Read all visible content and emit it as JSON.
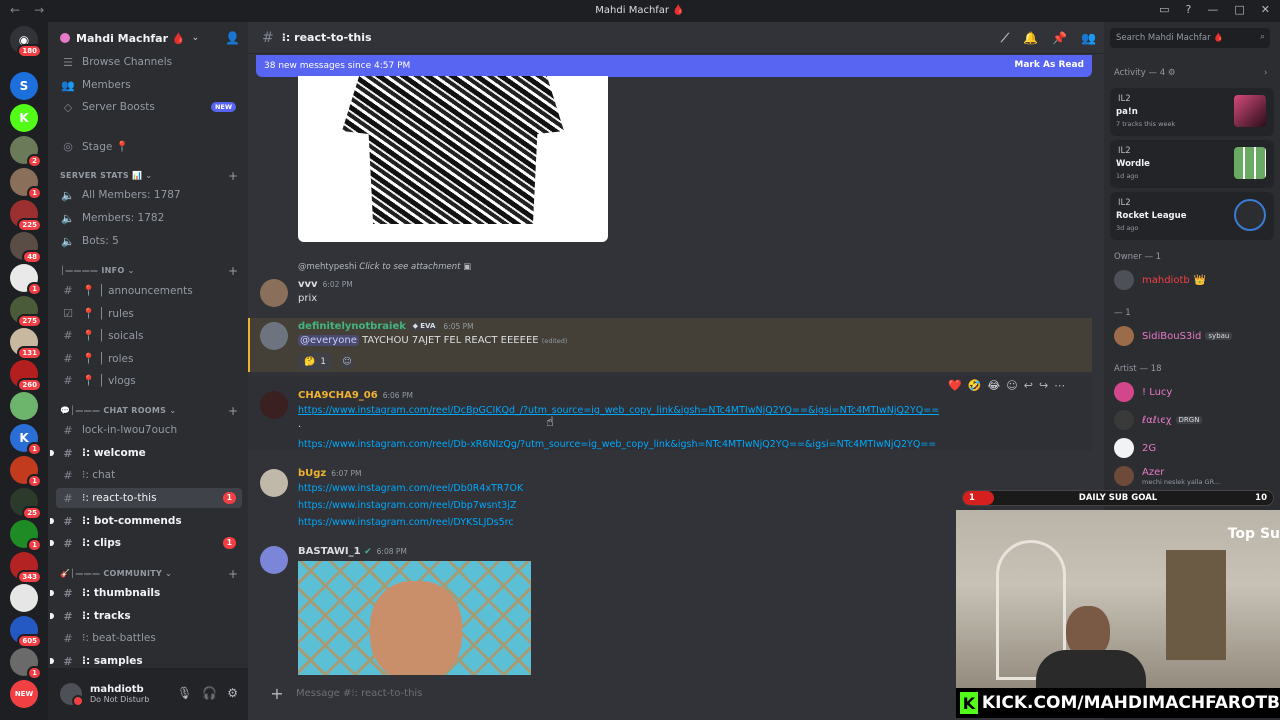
{
  "titlebar": {
    "title": "Mahdi Machfar 🩸"
  },
  "rail": {
    "home_badge": "180",
    "servers": [
      {
        "label": "S",
        "color": "#1d6fdc",
        "badge": ""
      },
      {
        "label": "K",
        "color": "#53fc18",
        "badge": ""
      },
      {
        "label": "",
        "color": "#6b7b5a",
        "badge": "2"
      },
      {
        "label": "",
        "color": "#8a6f5a",
        "badge": "1"
      },
      {
        "label": "",
        "color": "#9c2f2f",
        "badge": "225"
      },
      {
        "label": "",
        "color": "#5a4d46",
        "badge": "48"
      },
      {
        "label": "",
        "color": "#e9e9e9",
        "badge": "1"
      },
      {
        "label": "",
        "color": "#4a5b3a",
        "badge": "275"
      },
      {
        "label": "",
        "color": "#c9b8a0",
        "badge": "131"
      },
      {
        "label": "",
        "color": "#b31e1e",
        "badge": "260"
      },
      {
        "label": "",
        "color": "#6db56d",
        "badge": ""
      },
      {
        "label": "K",
        "color": "#2b6fd6",
        "badge": "1"
      },
      {
        "label": "",
        "color": "#c23b1e",
        "badge": "1"
      },
      {
        "label": "",
        "color": "#2b3a2a",
        "badge": "25"
      },
      {
        "label": "",
        "color": "#1f8b24",
        "badge": "1"
      },
      {
        "label": "",
        "color": "#b42323",
        "badge": "343"
      },
      {
        "label": "",
        "color": "#e6e6e6",
        "badge": ""
      },
      {
        "label": "",
        "color": "#2459c4",
        "badge": "605"
      },
      {
        "label": "",
        "color": "#6a6a6a",
        "badge": "1"
      },
      {
        "label": "NEW",
        "color": "#f23f43",
        "badge": ""
      }
    ]
  },
  "guild": {
    "name": "Mahdi Machfar 🩸",
    "browse": "Browse Channels",
    "members": "Members",
    "boosts": "Server Boosts",
    "boosts_badge": "NEW",
    "stage": "Stage 📍",
    "cat_stats": "SERVER STATS 📊",
    "stat_all": "All Members: 1787",
    "stat_members": "Members: 1782",
    "stat_bots": "Bots: 5",
    "cat_info": "│———— INFO",
    "info": [
      "📍 │ announcements",
      "📍 │ rules",
      "📍 │ soicals",
      "📍 │ roles",
      "📍 │ vlogs"
    ],
    "cat_chat": "💬│——— CHAT ROOMS",
    "lock": "lock-in-lwou7ouch",
    "welcome": "⁝: welcome",
    "chat": "⁝: chat",
    "react": "⁝: react-to-this",
    "react_count": "1",
    "botcmd": "⁝: bot-commends",
    "clips": "⁝: clips",
    "clips_count": "1",
    "cat_community": "🎸│——— COMMUNITY",
    "thumbnails": "⁝: thumbnails",
    "tracks": "⁝: tracks",
    "beat": "⁝: beat-battles",
    "samples": "⁝: samples"
  },
  "user": {
    "name": "mahdiotb",
    "status": "Do Not Disturb"
  },
  "chat": {
    "channel": "⁝: react-to-this",
    "new_messages": "38 new messages since 4:57 PM",
    "mark_read": "Mark As Read",
    "reply_ref": "@mehtypeshi",
    "reply_attach": "Click to see attachment",
    "messages": [
      {
        "author": "vvv",
        "time": "6:02 PM",
        "color": "#f2f3f5",
        "text": "prix"
      },
      {
        "author": "definitelynotbraiek",
        "tag": "EVA",
        "time": "6:05 PM",
        "color": "#43b581",
        "mention": "@everyone",
        "text": "TAYCHOU 7AJET FEL REACT EEEEEE",
        "edited": "(edited)",
        "reaction_count": "1"
      },
      {
        "author": "CHA9CHA9_06",
        "time": "6:06 PM",
        "color": "#f0b232",
        "links": [
          "https://www.instagram.com/reel/DcBpGCIKQd_/?utm_source=ig_web_copy_link&igsh=NTc4MTIwNjQ2YQ==&igsi=NTc4MTIwNjQ2YQ==",
          ".",
          "https://www.instagram.com/reel/Db-xR6NIzQg/?utm_source=ig_web_copy_link&igsh=NTc4MTIwNjQ2YQ==&igsi=NTc4MTIwNjQ2YQ=="
        ]
      },
      {
        "author": "bUgz",
        "time": "6:07 PM",
        "color": "#f0b232",
        "links": [
          "https://www.instagram.com/reel/Db0R4xTR7OK",
          "https://www.instagram.com/reel/Dbp7wsnt3jZ",
          "https://www.instagram.com/reel/DYKSLJDs5rc"
        ]
      },
      {
        "author": "BASTAWI_1",
        "time": "6:08 PM",
        "color": "#f2f3f5"
      }
    ],
    "composer_placeholder": "Message #⁝: react-to-this"
  },
  "right": {
    "search_placeholder": "Search Mahdi Machfar 🩸",
    "activity_header": "Activity — 4",
    "activities": [
      {
        "name": "IL2",
        "title": "pa!n",
        "detail": "7 tracks this week"
      },
      {
        "name": "IL2",
        "title": "Wordle",
        "detail": "1d ago"
      },
      {
        "name": "IL2",
        "title": "Rocket League",
        "detail": "3d ago"
      }
    ],
    "owner_header": "Owner — 1",
    "owner": "mahdiotb",
    "role_header": "— 1",
    "role_member": "SidiBouS3id",
    "role_member_tag": "sybau",
    "artist_header": "Artist — 18",
    "artists": [
      "! Lucy",
      "ℓαℓιєχ",
      "2G",
      "Azer"
    ],
    "artist_tag": "DRGN",
    "azer_status": "mechi neslek yalla GR..."
  },
  "overlay": {
    "goal_label": "DAILY SUB GOAL",
    "goal_current": "1",
    "goal_target": "10",
    "goal_progress": 0.1,
    "top_label": "Top Su",
    "kick_text": "KICK.COM/MAHDIMACHFAROTB"
  }
}
